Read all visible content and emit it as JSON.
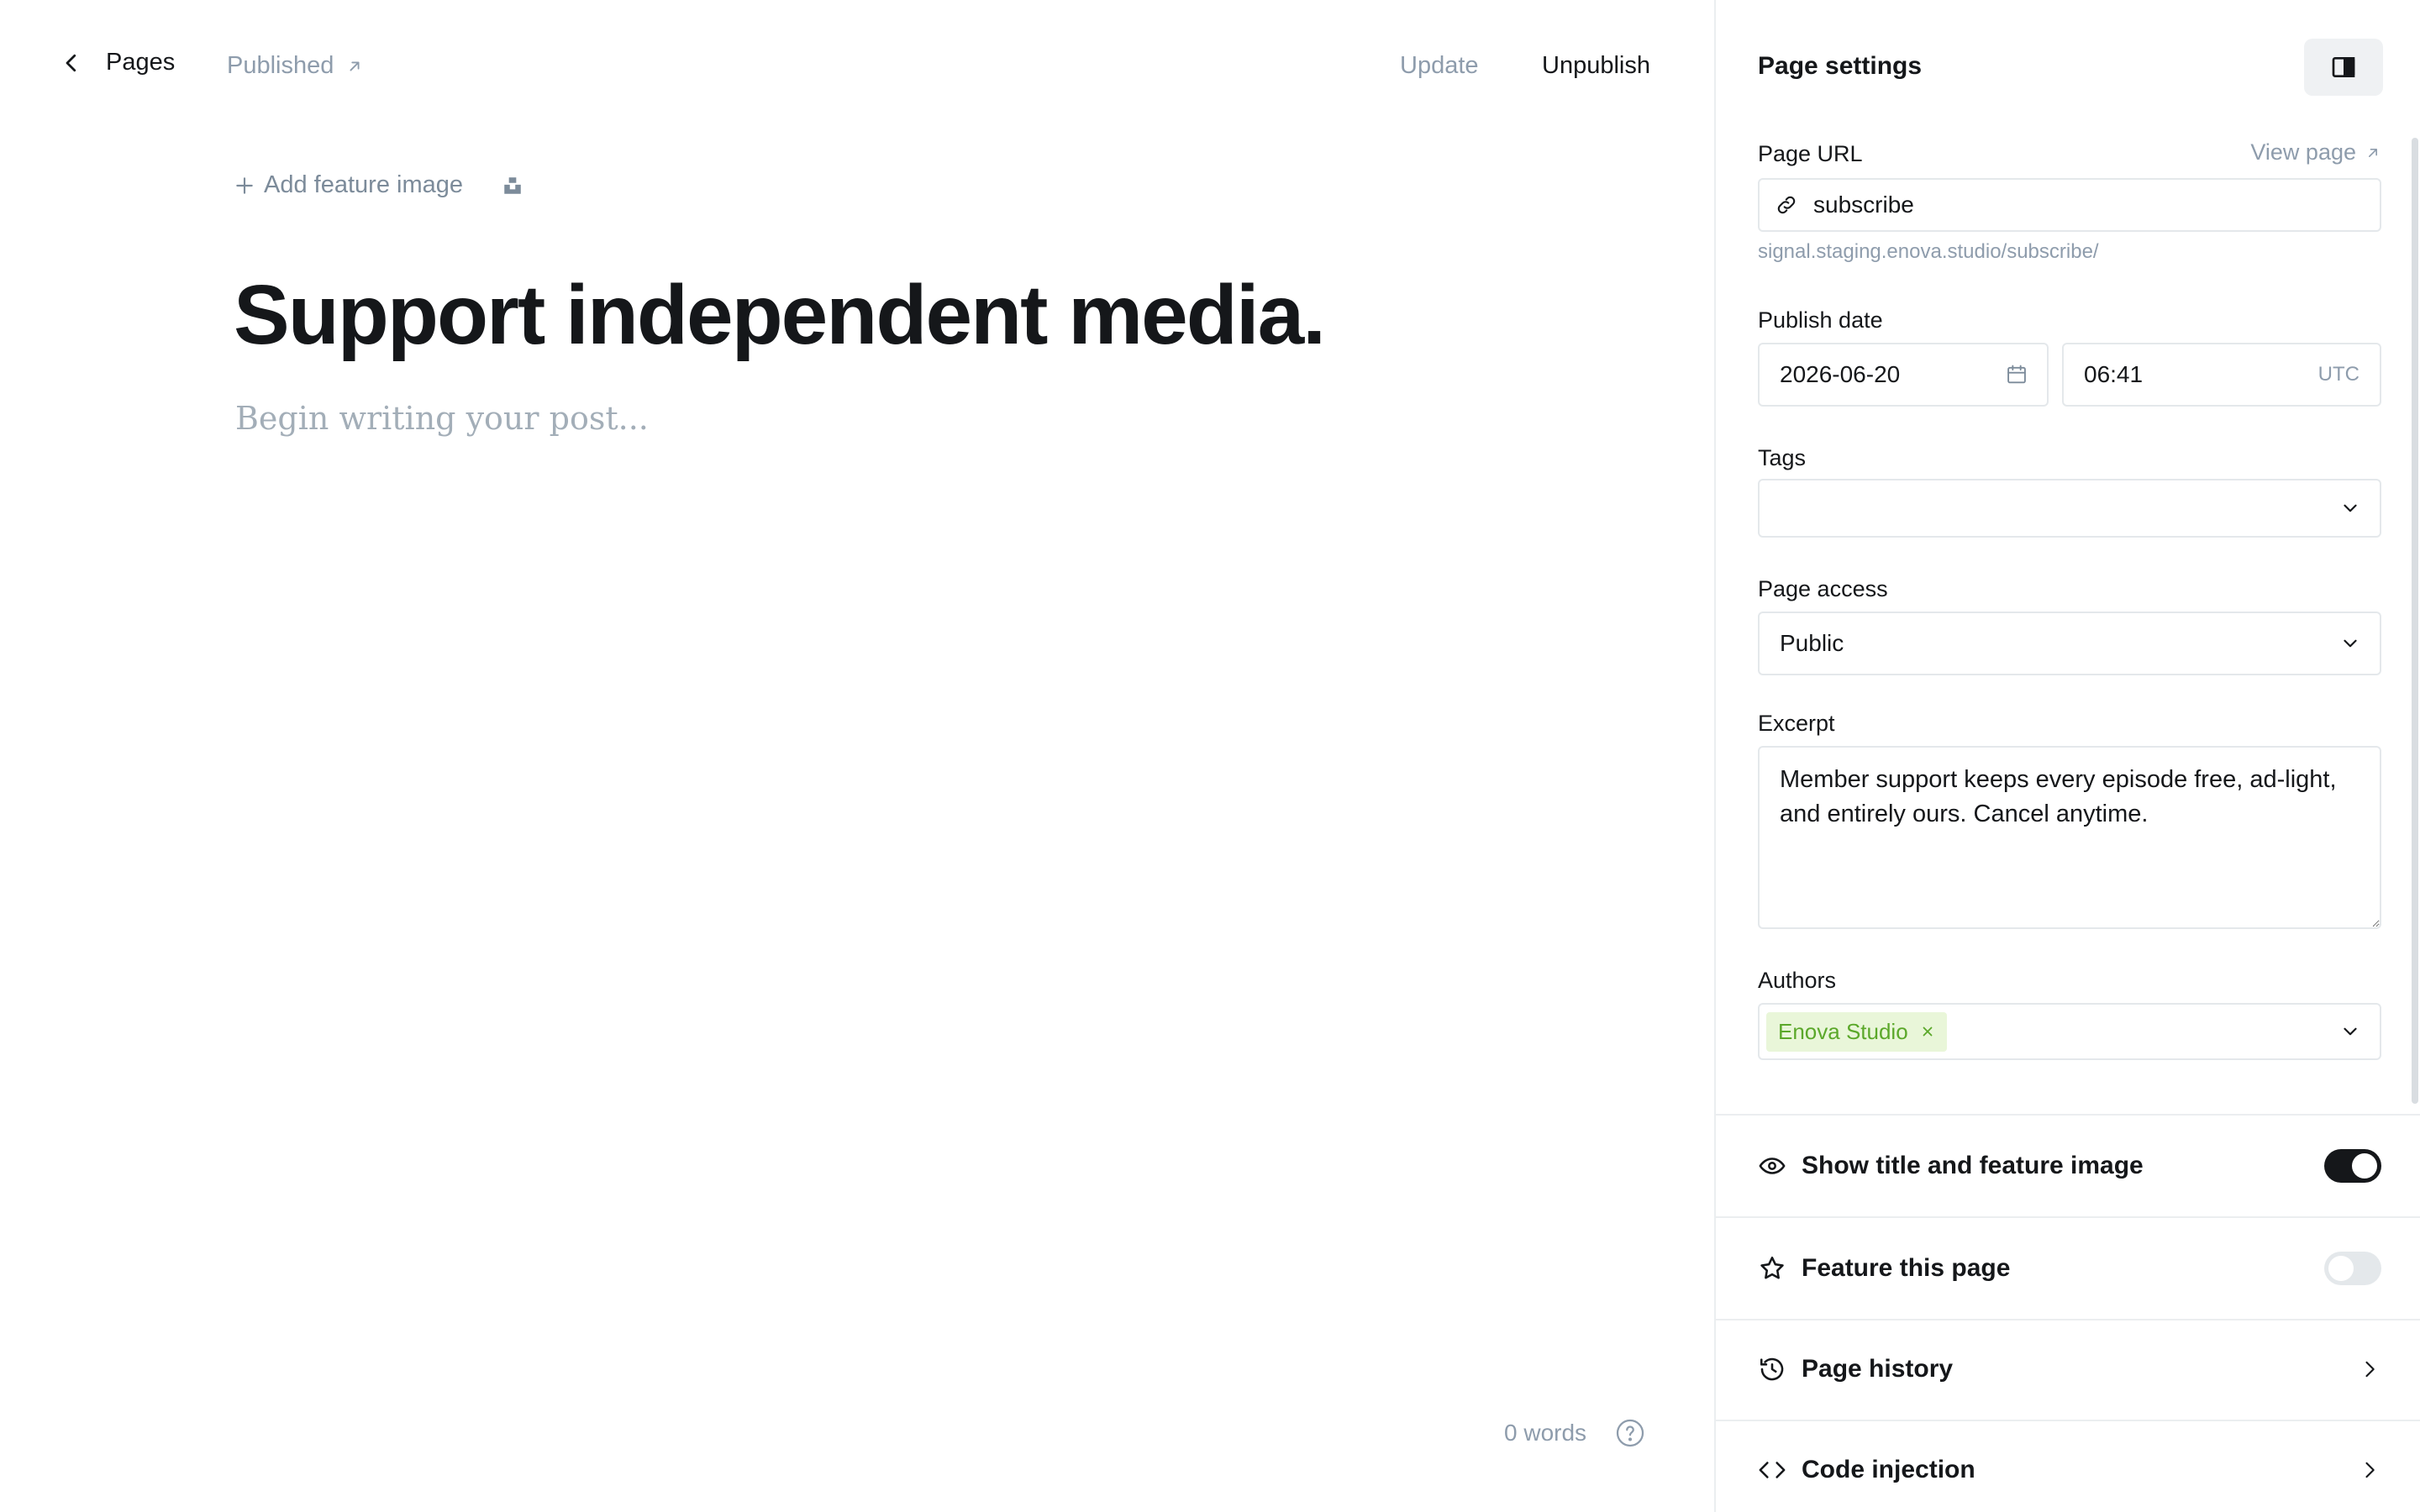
{
  "topbar": {
    "back_label": "Pages",
    "status_label": "Published",
    "update_label": "Update",
    "unpublish_label": "Unpublish"
  },
  "editor": {
    "add_feature_image_label": "Add feature image",
    "title": "Support independent media.",
    "body_placeholder": "Begin writing your post...",
    "word_count": "0 words"
  },
  "settings": {
    "title": "Page settings",
    "page_url": {
      "label": "Page URL",
      "view_page_label": "View page",
      "value": "subscribe",
      "hint": "signal.staging.enova.studio/subscribe/"
    },
    "publish_date": {
      "label": "Publish date",
      "date": "2026-06-20",
      "time": "06:41",
      "timezone": "UTC"
    },
    "tags": {
      "label": "Tags",
      "value": ""
    },
    "page_access": {
      "label": "Page access",
      "value": "Public"
    },
    "excerpt": {
      "label": "Excerpt",
      "value": "Member support keeps every episode free, ad-light, and entirely ours. Cancel anytime."
    },
    "authors": {
      "label": "Authors",
      "items": [
        "Enova Studio"
      ]
    },
    "show_title": {
      "label": "Show title and feature image",
      "enabled": true
    },
    "feature_page": {
      "label": "Feature this page",
      "enabled": false
    },
    "page_history_label": "Page history",
    "code_injection_label": "Code injection"
  },
  "colors": {
    "text": "#15171a",
    "muted": "#8e9cac",
    "border": "#e4e8eb",
    "author_chip_bg": "#e9f6d9",
    "author_chip_text": "#5ba82a",
    "toggle_on": "#15171a",
    "toggle_off": "#e4e8eb"
  }
}
